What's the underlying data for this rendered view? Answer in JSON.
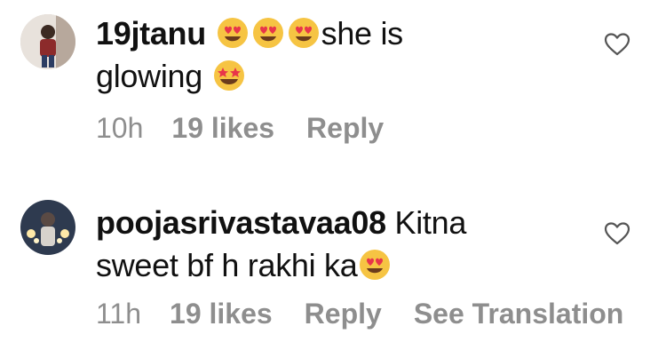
{
  "comments": [
    {
      "username": "19jtanu",
      "text_after_emojis": "she is",
      "text_line2": "glowing",
      "time": "10h",
      "likes": "19 likes",
      "reply": "Reply"
    },
    {
      "username": "poojasrivastavaa08",
      "text_line1": "Kitna",
      "text_line2": "sweet bf h rakhi ka",
      "time": "11h",
      "likes": "19 likes",
      "reply": "Reply",
      "see_translation": "See Translation"
    }
  ],
  "icons": {
    "heart_eyes": "heart-eyes-emoji",
    "star_struck": "star-struck-emoji",
    "like": "heart-outline-icon"
  },
  "colors": {
    "text": "#111111",
    "meta": "#8e8e8e",
    "emoji_face": "#f6c443",
    "emoji_heart": "#e8354a"
  }
}
